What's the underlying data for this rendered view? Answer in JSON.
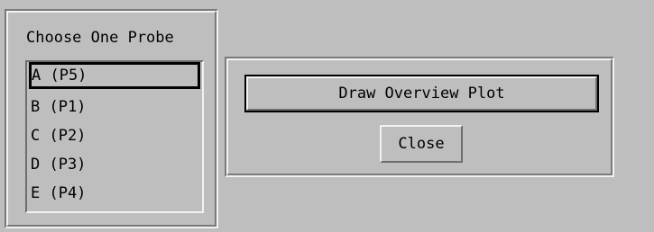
{
  "probe_panel": {
    "title": "Choose One Probe",
    "selected_index": 0,
    "items": [
      {
        "label": "A (P5)"
      },
      {
        "label": "B (P1)"
      },
      {
        "label": "C (P2)"
      },
      {
        "label": "D (P3)"
      },
      {
        "label": "E (P4)"
      }
    ]
  },
  "actions": {
    "draw_label": "Draw Overview Plot",
    "close_label": "Close"
  }
}
